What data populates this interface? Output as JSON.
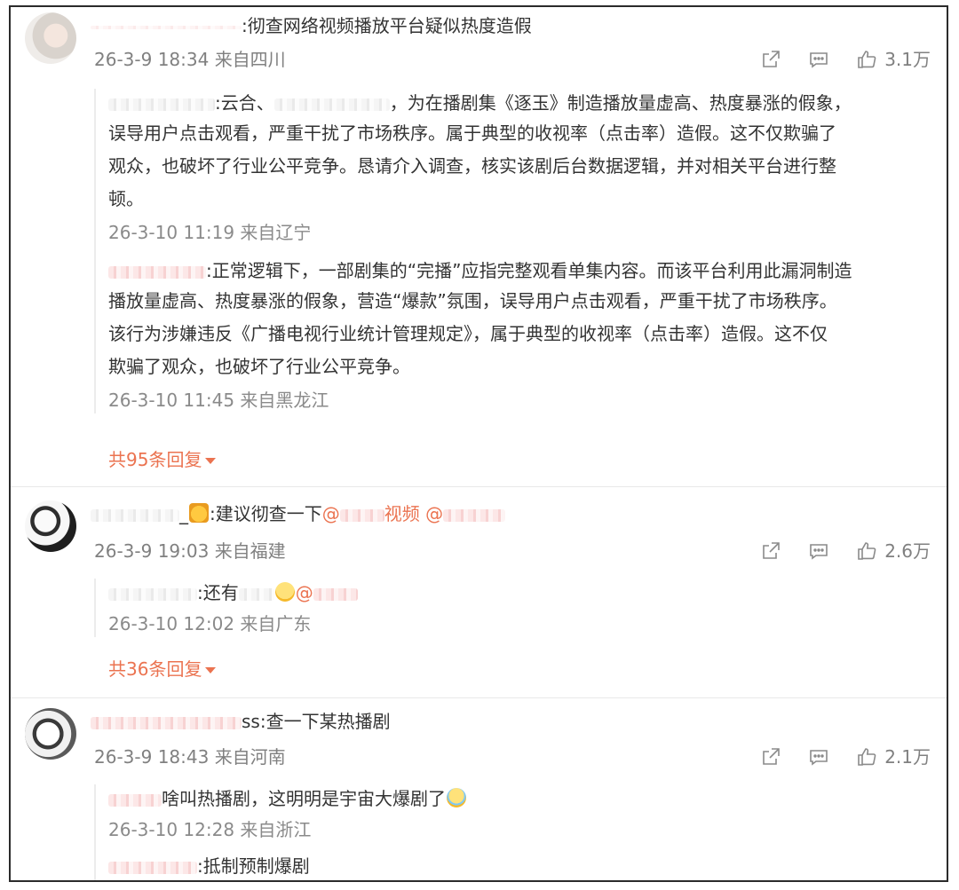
{
  "colors": {
    "accent": "#eb7350",
    "meta": "#808080",
    "text": "#333333"
  },
  "icons": {
    "share": "share-icon",
    "comment": "comment-icon",
    "like": "like-icon"
  },
  "comments": [
    {
      "text": ":彻查网络视频播放平台疑似热度造假",
      "time": "26-3-9 18:34",
      "location": "来自四川",
      "likes": "3.1万",
      "replies": [
        {
          "text": ":云合、",
          "text_b": "，为在播剧集《逐玉》制造播放量虚高、热度暴涨的假象，",
          "text_lines": [
            "误导用户点击观看，严重干扰了市场秩序。属于典型的收视率（点击率）造假。这不仅欺骗了",
            "观众，也破坏了行业公平竞争。恳请介入调查，核实该剧后台数据逻辑，并对相关平台进行整",
            "顿。"
          ],
          "time": "26-3-10 11:19",
          "location": "来自辽宁"
        },
        {
          "text": ":正常逻辑下，一部剧集的“完播”应指完整观看单集内容。而该平台利用此漏洞制造",
          "text_lines": [
            "播放量虚高、热度暴涨的假象，营造“爆款”氛围，误导用户点击观看，严重干扰了市场秩序。",
            "该行为涉嫌违反《广播电视行业统计管理规定》，属于典型的收视率（点击率）造假。这不仅",
            "欺骗了观众，也破坏了行业公平竞争。"
          ],
          "time": "26-3-10 11:45",
          "location": "来自黑龙江"
        }
      ],
      "more_replies": "共95条回复"
    },
    {
      "text_prefix": "_",
      "text": ":建议彻查一下",
      "mention1": "@",
      "mention1_b": "视频",
      "mention2": "@",
      "time": "26-3-9 19:03",
      "location": "来自福建",
      "likes": "2.6万",
      "replies": [
        {
          "text": ":还有",
          "mention": "@",
          "time": "26-3-10 12:02",
          "location": "来自广东"
        }
      ],
      "more_replies": "共36条回复"
    },
    {
      "text": "ss:查一下某热播剧",
      "time": "26-3-9 18:43",
      "location": "来自河南",
      "likes": "2.1万",
      "replies": [
        {
          "text": "啥叫热播剧，这明明是宇宙大爆剧了",
          "time": "26-3-10 12:28",
          "location": "来自浙江"
        },
        {
          "text": ":抵制预制爆剧"
        }
      ]
    }
  ]
}
